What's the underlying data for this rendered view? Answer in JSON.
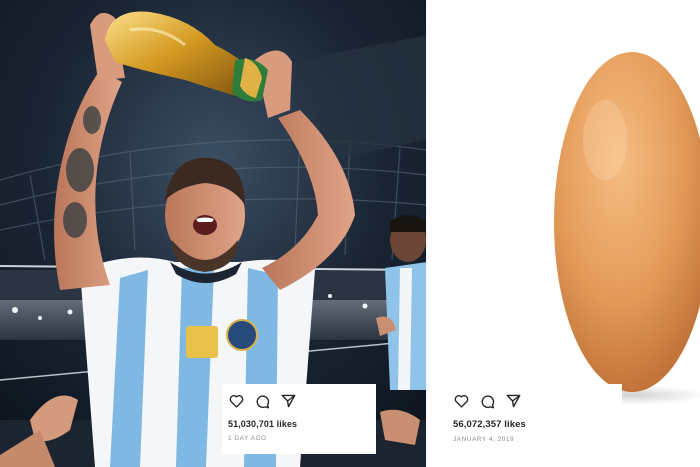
{
  "colors": {
    "stadium_bg": "#101a26",
    "jersey_blue": "#7fb8e3",
    "trophy_gold": "#d8a12b",
    "egg_orange": "#e59c5a",
    "text_dark": "#262626",
    "text_muted": "#8e8e8e"
  },
  "posts": [
    {
      "image": "player-raising-trophy-photo",
      "actions": [
        "heart-icon",
        "comment-icon",
        "share-icon"
      ],
      "likes": "51,030,701 likes",
      "date": "1 DAY AGO"
    },
    {
      "image": "egg-photo",
      "actions": [
        "heart-icon",
        "comment-icon",
        "share-icon"
      ],
      "likes": "56,072,357 likes",
      "date": "JANUARY 4, 2019"
    }
  ]
}
